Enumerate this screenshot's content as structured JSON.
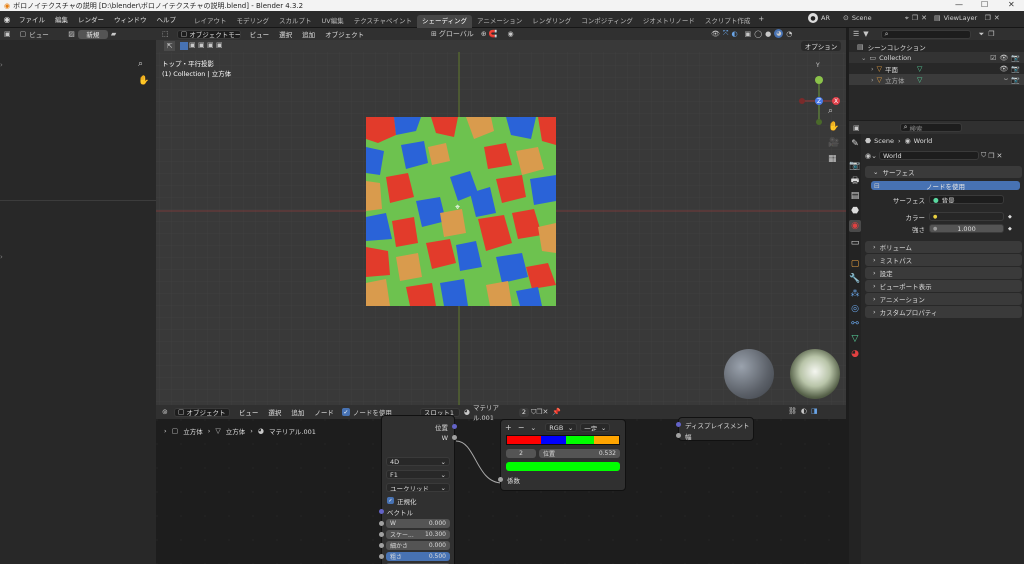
{
  "window": {
    "title": "ボロノイテクスチャの説明 [D:\\blender\\ボロノイテクスチャの説明.blend] - Blender 4.3.2",
    "minimize": "—",
    "maximize": "☐",
    "close": "✕"
  },
  "menu": [
    "ファイル",
    "編集",
    "レンダー",
    "ウィンドウ",
    "ヘルプ"
  ],
  "workspaces": [
    {
      "label": "レイアウト",
      "active": false
    },
    {
      "label": "モデリング",
      "active": false
    },
    {
      "label": "スカルプト",
      "active": false
    },
    {
      "label": "UV編集",
      "active": false
    },
    {
      "label": "テクスチャペイント",
      "active": false
    },
    {
      "label": "シェーディング",
      "active": true
    },
    {
      "label": "アニメーション",
      "active": false
    },
    {
      "label": "レンダリング",
      "active": false
    },
    {
      "label": "コンポジティング",
      "active": false
    },
    {
      "label": "ジオメトリノード",
      "active": false
    },
    {
      "label": "スクリプト作成",
      "active": false
    }
  ],
  "topright": {
    "ar": "AR",
    "scene": "Scene",
    "view_layer": "ViewLayer"
  },
  "left": {
    "view": "ビュー",
    "new": "新規"
  },
  "viewport": {
    "mode": "オブジェクトモード",
    "menus": [
      "ビュー",
      "選択",
      "追加",
      "オブジェクト"
    ],
    "transform": "グローバル",
    "options": "オプション",
    "info_line1": "トップ・平行投影",
    "info_line2": "(1) Collection | 立方体",
    "gizmo": {
      "y": "Y",
      "x": "X",
      "z": "Z"
    }
  },
  "outliner": {
    "search_placeholder": "",
    "root": "シーンコレクション",
    "collection": "Collection",
    "items": [
      "平面",
      "立方体"
    ]
  },
  "properties": {
    "search_placeholder": "検索",
    "scene": "Scene",
    "world_crumb": "World",
    "world_name": "World",
    "surface": "サーフェス",
    "use_nodes": "ノードを使用",
    "surface_label": "サーフェス",
    "surface_value": "背景",
    "color_label": "カラー",
    "strength_label": "強さ",
    "strength_value": "1.000",
    "sections": [
      "ボリューム",
      "ミストパス",
      "設定",
      "ビューポート表示",
      "アニメーション",
      "カスタムプロパティ"
    ]
  },
  "node_editor": {
    "type": "オブジェクト",
    "menus": [
      "ビュー",
      "選択",
      "追加",
      "ノード"
    ],
    "use_nodes": "ノードを使用",
    "slot": "スロット1",
    "material": "マテリアル.001",
    "users": "2",
    "breadcrumb": [
      "立方体",
      "立方体",
      "マテリアル.001"
    ]
  },
  "voronoi": {
    "out_pos": "位置",
    "out_w": "W",
    "dim": "4D",
    "feature": "F1",
    "metric": "ユークリッド",
    "normalize": "正規化",
    "vector": "ベクトル",
    "fields": [
      {
        "label": "W",
        "value": "0.000"
      },
      {
        "label": "スケー...",
        "value": "10.300"
      },
      {
        "label": "細かさ",
        "value": "0.000"
      },
      {
        "label": "粗さ",
        "value": "0.500"
      },
      {
        "label": "空隙性",
        "value": "1.000"
      }
    ]
  },
  "colorramp": {
    "plus": "+",
    "minus": "−",
    "mode": "RGB",
    "interp": "一定",
    "index": "2",
    "pos_label": "位置",
    "pos_value": "0.532",
    "factor": "係数"
  },
  "output": {
    "displacement": "ディスプレイスメント",
    "width": "幅"
  }
}
